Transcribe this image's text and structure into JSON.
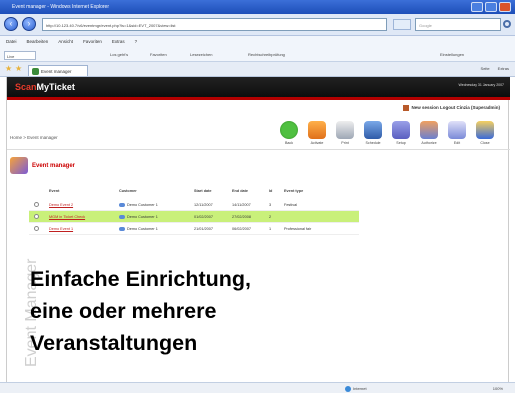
{
  "window": {
    "title": "Event manager - Windows Internet Explorer"
  },
  "browser": {
    "url": "http://10.123.40.7/v6/eventmgr/event.php?ls=1&sid=EVT_2007&view=list",
    "search_placeholder": "Google",
    "menu": [
      "Datei",
      "Bearbeiten",
      "Ansicht",
      "Favoriten",
      "Extras",
      "?"
    ],
    "links_left": "Live",
    "links_items": [
      "Los geht's",
      "Favoriten",
      "Lesezeichen",
      "Rechtschreibprüfung",
      "Einstellungen"
    ],
    "tab_label": "Event manager",
    "tab_tools": [
      "Seite",
      "Extras"
    ]
  },
  "app": {
    "logo_prefix": "Scan",
    "logo_suffix": "MyTicket",
    "date_text": "Wednesday 31 January 2007",
    "user_bar": "New session  Logout  Cinzia (Superadmin)",
    "breadcrumb": "Home > Event manager",
    "page_title": "Event manager",
    "toolbar": [
      {
        "label": "Back",
        "icon": "back-icon",
        "cls": "ic-back"
      },
      {
        "label": "Activate",
        "icon": "activate-icon",
        "cls": "ic-activate"
      },
      {
        "label": "Print",
        "icon": "print-icon",
        "cls": "ic-print"
      },
      {
        "label": "Schedule",
        "icon": "schedule-icon",
        "cls": "ic-schedule"
      },
      {
        "label": "Setup",
        "icon": "setup-icon",
        "cls": "ic-setup"
      },
      {
        "label": "Authorize",
        "icon": "authorize-icon",
        "cls": "ic-authorize"
      },
      {
        "label": "Edit",
        "icon": "edit-icon",
        "cls": "ic-edit"
      },
      {
        "label": "Close",
        "icon": "close-icon",
        "cls": "ic-close"
      }
    ],
    "grid": {
      "headers": [
        "Event",
        "Customer",
        "Start date",
        "End date",
        "Id",
        "Event type"
      ],
      "rows": [
        {
          "event": "Demo Event 2",
          "customer": "Demo Customer 1",
          "start": "12/11/2007",
          "end": "14/11/2007",
          "id": "3",
          "type": "Festival",
          "highlight": false
        },
        {
          "event": "MGM in Ticket Check",
          "customer": "Demo Customer 1",
          "start": "01/02/2007",
          "end": "27/02/2008",
          "id": "2",
          "type": "",
          "highlight": true
        },
        {
          "event": "Demo Event 1",
          "customer": "Demo Customer 1",
          "start": "21/01/2007",
          "end": "06/02/2007",
          "id": "1",
          "type": "Professional fair",
          "highlight": false
        }
      ]
    },
    "side_label": "Event Manager"
  },
  "caption": [
    "Einfache Einrichtung,",
    "eine oder mehrere",
    "Veranstaltungen"
  ],
  "status": {
    "zone": "Internet",
    "zoom": "100%"
  }
}
